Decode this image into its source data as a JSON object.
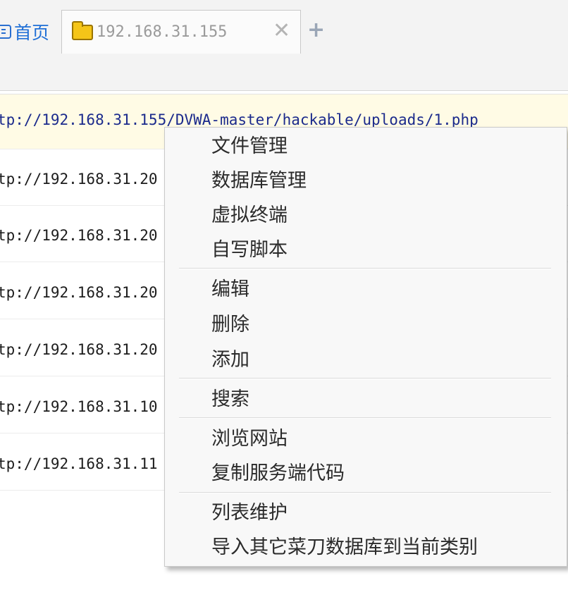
{
  "tabs": {
    "home_label": "首页",
    "active_label": "192.168.31.155",
    "close_glyph": "✕",
    "add_glyph": "+"
  },
  "url_list": [
    {
      "text": "tp://192.168.31.155/DVWA-master/hackable/uploads/1.php",
      "selected": true
    },
    {
      "text": "tp://192.168.31.20",
      "selected": false
    },
    {
      "text": "tp://192.168.31.20",
      "selected": false
    },
    {
      "text": "tp://192.168.31.20",
      "selected": false
    },
    {
      "text": "tp://192.168.31.20",
      "selected": false
    },
    {
      "text": "tp://192.168.31.10",
      "selected": false
    },
    {
      "text": "tp://192.168.31.11",
      "selected": false
    }
  ],
  "context_menu": {
    "items": [
      "文件管理",
      "数据库管理",
      "虚拟终端",
      "自写脚本",
      "编辑",
      "删除",
      "添加",
      "搜索",
      "浏览网站",
      "复制服务端代码",
      "列表维护",
      "导入其它菜刀数据库到当前类别"
    ]
  },
  "icons": {
    "home": "home-page-icon",
    "folder": "folder-icon",
    "close": "close-icon",
    "add": "plus-icon"
  },
  "colors": {
    "home_link": "#1f6fd6",
    "selected_row_bg": "#fffbe5",
    "selected_url": "#1b2a8c",
    "folder_yellow": "#f5c518"
  }
}
